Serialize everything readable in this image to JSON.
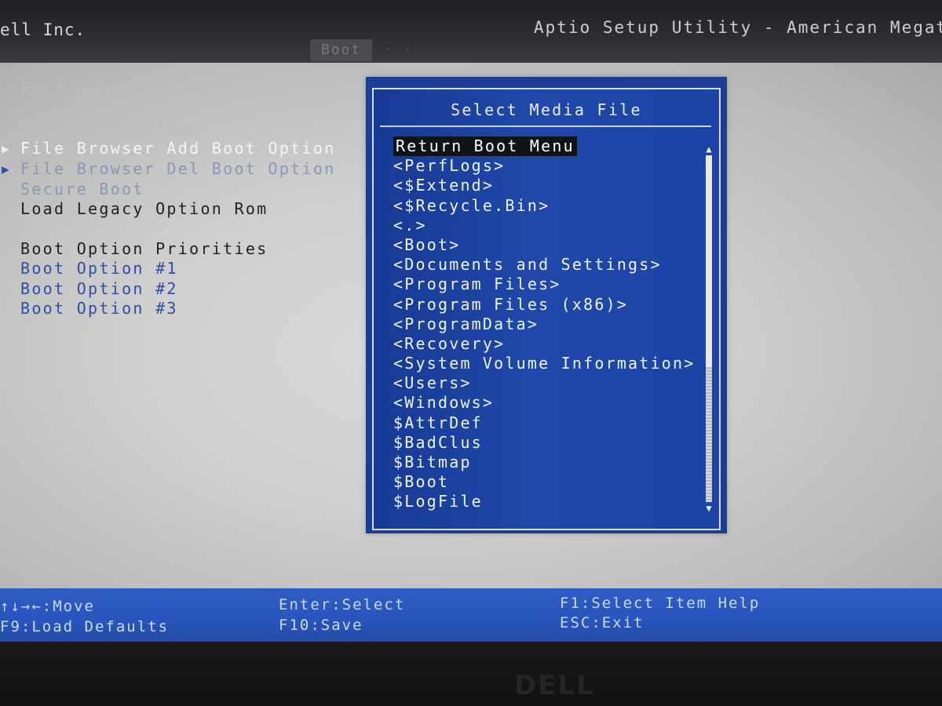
{
  "header": {
    "vendor": "ell Inc.",
    "utility_title": "Aptio Setup Utility - American Megatr",
    "menu_tabs": [
      {
        "label": "Boot",
        "active": true
      },
      {
        "label": "· ·",
        "active": false
      }
    ]
  },
  "boot_menu": {
    "fast_boot": "Fast Boot",
    "boot_list_option": "Boot List Option",
    "file_browser_add": "File Browser Add Boot Option",
    "file_browser_del": "File Browser Del Boot Option",
    "secure_boot": "Secure Boot",
    "load_legacy": "Load Legacy Option Rom",
    "priorities_heading": "Boot Option Priorities",
    "boot_options": [
      "Boot Option #1",
      "Boot Option #2",
      "Boot Option #3"
    ],
    "submenu_arrow": "▶"
  },
  "popup": {
    "title": "Select Media File",
    "items": [
      "Return Boot Menu",
      "<PerfLogs>",
      "<$Extend>",
      "<$Recycle.Bin>",
      "<.>",
      "<Boot>",
      "<Documents and Settings>",
      "<Program Files>",
      "<Program Files (x86)>",
      "<ProgramData>",
      "<Recovery>",
      "<System Volume Information>",
      "<Users>",
      "<Windows>",
      "$AttrDef",
      "$BadClus",
      "$Bitmap",
      "$Boot",
      "$LogFile"
    ],
    "selected_index": 0,
    "scroll_up": "▲",
    "scroll_down": "▼"
  },
  "footer": {
    "move": "↑↓→←:Move",
    "load_defaults": "F9:Load Defaults",
    "enter_select": "Enter:Select",
    "f10_save": "F10:Save",
    "f1_help": "F1:Select Item Help",
    "esc_exit": "ESC:Exit"
  },
  "bezel": {
    "logo": "DELL"
  },
  "colors": {
    "popup_bg": "#1b3d93",
    "footer_bg": "#2855bd",
    "panel_bg": "#cfcfcd",
    "option_blue": "#2d4fa6"
  }
}
